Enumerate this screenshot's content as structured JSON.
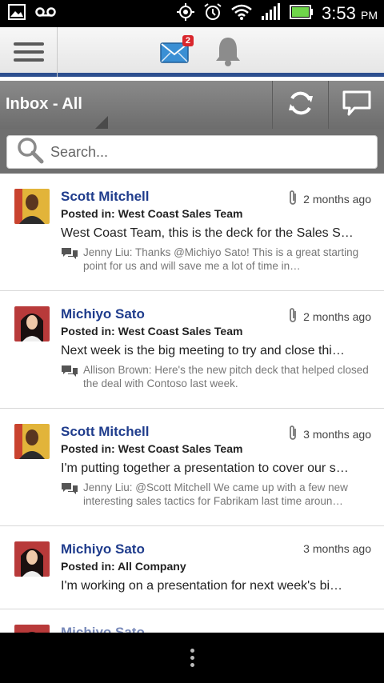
{
  "status_bar": {
    "time": "3:53",
    "ampm": "PM"
  },
  "header": {
    "mail_badge": "2"
  },
  "inbox": {
    "title": "Inbox - All"
  },
  "search": {
    "placeholder": "Search..."
  },
  "feed": [
    {
      "author": "Scott Mitchell",
      "posted_label": "Posted in:",
      "group": "West Coast Sales Team",
      "time": "2 months ago",
      "has_attachment": true,
      "message": "West Coast Team, this is the deck for the Sales S…",
      "reply": "Jenny Liu: Thanks @Michiyo Sato! This is a great starting point for us and will save me a lot of time in…"
    },
    {
      "author": "Michiyo Sato",
      "posted_label": "Posted in:",
      "group": "West Coast Sales Team",
      "time": "2 months ago",
      "has_attachment": true,
      "message": "Next week is the big meeting to try and close thi…",
      "reply": "Allison Brown: Here's the new pitch deck that helped closed the deal with Contoso last week."
    },
    {
      "author": "Scott Mitchell",
      "posted_label": "Posted in:",
      "group": "West Coast Sales Team",
      "time": "3 months ago",
      "has_attachment": true,
      "message": "I'm putting together a presentation to cover our s…",
      "reply": "Jenny Liu: @Scott Mitchell We came up with a few new interesting sales tactics for Fabrikam last time aroun…"
    },
    {
      "author": "Michiyo Sato",
      "posted_label": "Posted in:",
      "group": "All Company",
      "time": "3 months ago",
      "has_attachment": false,
      "message": "I'm working on a presentation for next week's bi…",
      "reply": ""
    }
  ],
  "partial_item": {
    "author": "Michiyo Sato"
  },
  "colors": {
    "accent": "#2d4f8f",
    "name": "#1f3c8c",
    "badge": "#d9262c"
  }
}
